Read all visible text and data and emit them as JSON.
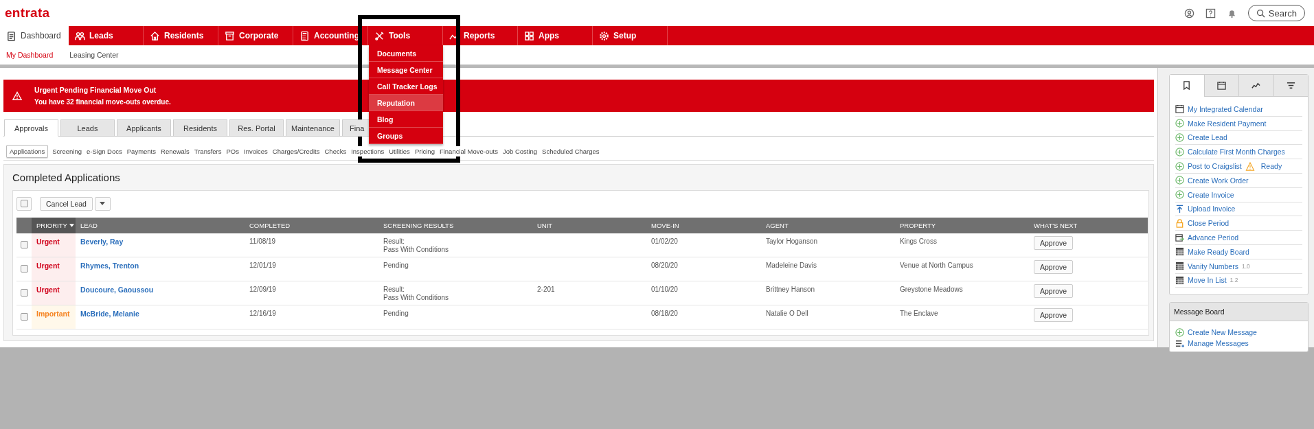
{
  "logo": "entrata",
  "search": {
    "label": "Search"
  },
  "nav": [
    {
      "label": "Dashboard",
      "selected": true,
      "expanded": false
    },
    {
      "label": "Leads",
      "selected": false,
      "expanded": false
    },
    {
      "label": "Residents",
      "selected": false,
      "expanded": false
    },
    {
      "label": "Corporate",
      "selected": false,
      "expanded": false
    },
    {
      "label": "Accounting",
      "selected": false,
      "expanded": false
    },
    {
      "label": "Tools",
      "selected": false,
      "expanded": true
    },
    {
      "label": "Reports",
      "selected": false,
      "expanded": false
    },
    {
      "label": "Apps",
      "selected": false,
      "expanded": false
    },
    {
      "label": "Setup",
      "selected": false,
      "expanded": false
    }
  ],
  "tools_menu": [
    {
      "label": "Documents",
      "highlighted": false
    },
    {
      "label": "Message Center",
      "highlighted": false
    },
    {
      "label": "Call Tracker Logs",
      "highlighted": false
    },
    {
      "label": "Reputation",
      "highlighted": true
    },
    {
      "label": "Blog",
      "highlighted": false
    },
    {
      "label": "Groups",
      "highlighted": false
    }
  ],
  "subnav": [
    {
      "label": "My Dashboard",
      "selected": true
    },
    {
      "label": "Leasing Center",
      "selected": false
    }
  ],
  "alert": {
    "title": "Urgent Pending Financial Move Out",
    "message": "You have 32 financial move-outs overdue."
  },
  "tabs": [
    {
      "label": "Approvals",
      "selected": true
    },
    {
      "label": "Leads",
      "selected": false
    },
    {
      "label": "Applicants",
      "selected": false
    },
    {
      "label": "Residents",
      "selected": false
    },
    {
      "label": "Res. Portal",
      "selected": false
    },
    {
      "label": "Maintenance",
      "selected": false
    },
    {
      "label": "Fina",
      "selected": false
    }
  ],
  "subtabs": [
    {
      "label": "Applications",
      "selected": true
    },
    {
      "label": "Screening",
      "selected": false
    },
    {
      "label": "e-Sign Docs",
      "selected": false
    },
    {
      "label": "Payments",
      "selected": false
    },
    {
      "label": "Renewals",
      "selected": false
    },
    {
      "label": "Transfers",
      "selected": false
    },
    {
      "label": "POs",
      "selected": false
    },
    {
      "label": "Invoices",
      "selected": false
    },
    {
      "label": "Charges/Credits",
      "selected": false
    },
    {
      "label": "Checks",
      "selected": false
    },
    {
      "label": "Inspections",
      "selected": false
    },
    {
      "label": "Utilities",
      "selected": false
    },
    {
      "label": "Pricing",
      "selected": false
    },
    {
      "label": "Financial Move-outs",
      "selected": false
    },
    {
      "label": "Job Costing",
      "selected": false
    },
    {
      "label": "Scheduled Charges",
      "selected": false
    }
  ],
  "panel": {
    "title": "Completed Applications",
    "bulk_checked": false,
    "bulk_action": "Cancel Lead",
    "columns": [
      {
        "label": "PRIORITY",
        "sorted": true
      },
      {
        "label": "LEAD",
        "sorted": false
      },
      {
        "label": "COMPLETED",
        "sorted": false
      },
      {
        "label": "SCREENING RESULTS",
        "sorted": false
      },
      {
        "label": "UNIT",
        "sorted": false
      },
      {
        "label": "MOVE-IN",
        "sorted": false
      },
      {
        "label": "AGENT",
        "sorted": false
      },
      {
        "label": "PROPERTY",
        "sorted": false
      },
      {
        "label": "WHAT'S NEXT",
        "sorted": false
      }
    ],
    "rows": [
      {
        "checked": false,
        "priority": "Urgent",
        "kind": "urgent",
        "lead": "Beverly, Ray",
        "completed": "11/08/19",
        "screening": [
          "Result:",
          "Pass With Conditions"
        ],
        "move_in": "01/02/20",
        "agent": "Taylor Hoganson",
        "property": "Kings Cross",
        "action": "Approve"
      },
      {
        "checked": false,
        "priority": "Urgent",
        "kind": "urgent",
        "lead": "Rhymes, Trenton",
        "completed": "12/01/19",
        "screening": [
          "Pending"
        ],
        "move_in": "08/20/20",
        "agent": "Madeleine Davis",
        "property": "Venue at North Campus",
        "action": "Approve"
      },
      {
        "checked": false,
        "priority": "Urgent",
        "kind": "urgent",
        "lead": "Doucoure, Gaoussou",
        "completed": "12/09/19",
        "screening": [
          "Result:",
          "Pass With Conditions"
        ],
        "unit": "2-201",
        "move_in": "01/10/20",
        "agent": "Brittney Hanson",
        "property": "Greystone Meadows",
        "action": "Approve"
      },
      {
        "checked": false,
        "priority": "Important",
        "kind": "important",
        "lead": "McBride, Melanie",
        "completed": "12/16/19",
        "screening": [
          "Pending"
        ],
        "move_in": "08/18/20",
        "agent": "Natalie O Dell",
        "property": "The Enclave",
        "action": "Approve"
      }
    ]
  },
  "sidebar_tabs": [
    {
      "kind": "bookmark",
      "selected": true
    },
    {
      "kind": "calendar",
      "selected": false
    },
    {
      "kind": "chart",
      "selected": false
    },
    {
      "kind": "filter",
      "selected": false
    }
  ],
  "quick_links": [
    {
      "kind": "calendar",
      "label": "My Integrated Calendar"
    },
    {
      "kind": "add",
      "label": "Make Resident Payment"
    },
    {
      "kind": "add",
      "label": "Create Lead"
    },
    {
      "kind": "add",
      "label": "Calculate First Month Charges"
    },
    {
      "kind": "add",
      "label": "Post to Craigslist",
      "status": "Ready"
    },
    {
      "kind": "add",
      "label": "Create Work Order"
    },
    {
      "kind": "add",
      "label": "Create Invoice"
    },
    {
      "kind": "upload",
      "label": "Upload Invoice"
    },
    {
      "kind": "lock",
      "label": "Close Period"
    },
    {
      "kind": "advance",
      "label": "Advance Period"
    },
    {
      "kind": "grid",
      "label": "Make Ready Board"
    },
    {
      "kind": "grid",
      "label": "Vanity Numbers",
      "version": "1.0"
    },
    {
      "kind": "grid",
      "label": "Move In List",
      "version": "1.2"
    }
  ],
  "message_board": {
    "title": "Message Board",
    "links": [
      {
        "kind": "add",
        "label": "Create New Message"
      },
      {
        "kind": "list",
        "label": "Manage Messages"
      }
    ]
  }
}
